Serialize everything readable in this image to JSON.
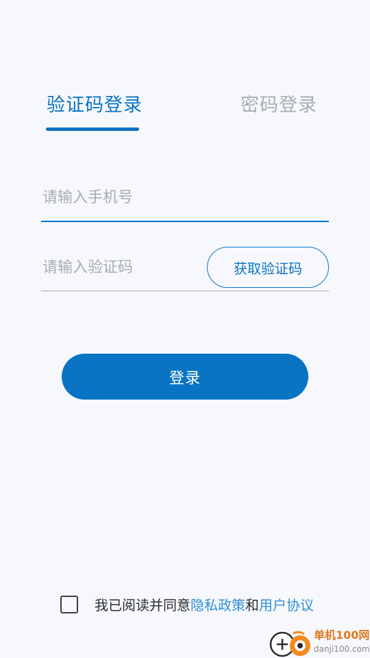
{
  "tabs": {
    "sms_login": "验证码登录",
    "password_login": "密码登录",
    "active": "sms_login"
  },
  "phone": {
    "placeholder": "请输入手机号",
    "value": ""
  },
  "code": {
    "placeholder": "请输入验证码",
    "value": "",
    "get_code_label": "获取验证码"
  },
  "login": {
    "label": "登录"
  },
  "agreement": {
    "checked": false,
    "prefix": "我已阅读并同意",
    "privacy_link": "隐私政策",
    "conjunction": "和",
    "terms_link": "用户协议"
  },
  "watermark": {
    "name": "单机100网",
    "domain": "danji100.com",
    "icon": "danji100-logo-icon"
  },
  "colors": {
    "accent": "#0a74c4",
    "link": "#2f8fd6",
    "inactive": "#a9adb3",
    "background": "#f6f8fc"
  }
}
